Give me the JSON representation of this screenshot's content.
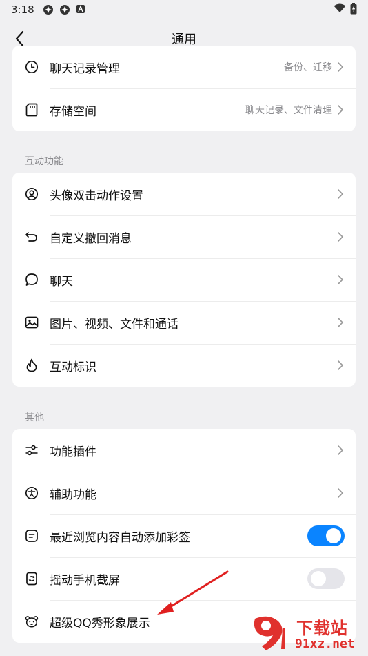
{
  "status_bar": {
    "time": "3:18"
  },
  "nav": {
    "title": "通用"
  },
  "top_card": [
    {
      "label": "聊天记录管理",
      "value": "备份、迁移",
      "icon": "clock-icon"
    },
    {
      "label": "存储空间",
      "value": "聊天记录、文件清理",
      "icon": "sd-card-icon"
    }
  ],
  "sections": {
    "interactive": {
      "title": "互动功能",
      "items": [
        {
          "label": "头像双击动作设置",
          "icon": "avatar-icon"
        },
        {
          "label": "自定义撤回消息",
          "icon": "undo-icon"
        },
        {
          "label": "聊天",
          "icon": "chat-bubble-icon"
        },
        {
          "label": "图片、视频、文件和通话",
          "icon": "image-icon"
        },
        {
          "label": "互动标识",
          "icon": "flame-icon"
        }
      ]
    },
    "other": {
      "title": "其他",
      "items": [
        {
          "label": "功能插件",
          "icon": "sliders-icon",
          "control": "chevron"
        },
        {
          "label": "辅助功能",
          "icon": "accessibility-icon",
          "control": "chevron"
        },
        {
          "label": "最近浏览内容自动添加彩签",
          "icon": "tag-icon",
          "control": "toggle",
          "toggle_on": true
        },
        {
          "label": "摇动手机截屏",
          "icon": "shake-phone-icon",
          "control": "toggle",
          "toggle_on": false
        },
        {
          "label": "超级QQ秀形象展示",
          "icon": "bear-face-icon",
          "control": "none"
        }
      ]
    }
  },
  "watermark": {
    "text": "下载站",
    "url": "91xz.net"
  },
  "colors": {
    "accent": "#0a84ff",
    "annotation_arrow": "#e02020",
    "watermark": "#e0312d"
  }
}
